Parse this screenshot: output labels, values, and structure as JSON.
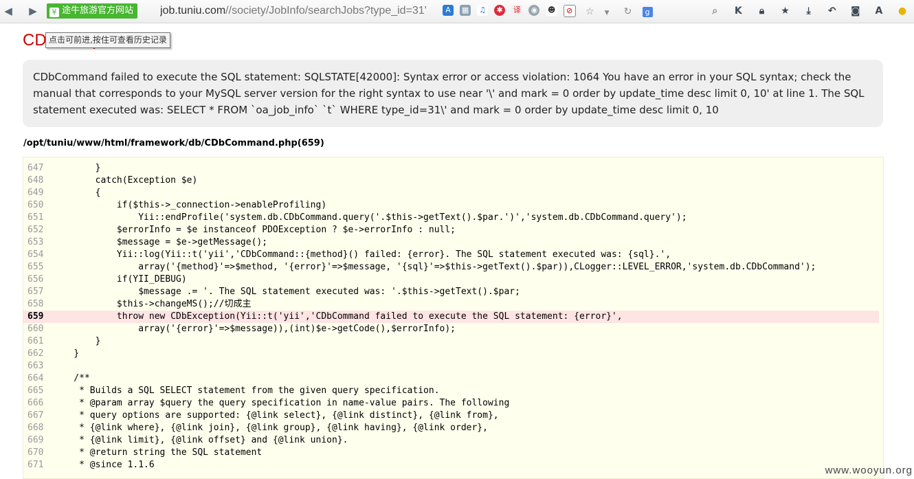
{
  "browser": {
    "site_badge": "途牛旅游官方网站",
    "url_host": "job.tuniu.com",
    "url_path": "//society/JobInfo/searchJobs?type_id=31'",
    "tooltip": "点击可前进,按住可查看历史记录",
    "right_icons": [
      "K",
      "A"
    ]
  },
  "error": {
    "title": "CDbException",
    "message": "CDbCommand failed to execute the SQL statement: SQLSTATE[42000]: Syntax error or access violation: 1064 You have an error in your SQL syntax; check the manual that corresponds to your MySQL server version for the right syntax to use near '\\' and mark = 0 order by update_time desc limit 0, 10' at line 1. The SQL statement executed was: SELECT * FROM `oa_job_info` `t` WHERE type_id=31\\' and mark = 0 order by update_time desc limit 0, 10",
    "file_ref": "/opt/tuniu/www/html/framework/db/CDbCommand.php(659)"
  },
  "source": {
    "error_line": 659,
    "lines": [
      {
        "n": "647",
        "code": "        }"
      },
      {
        "n": "648",
        "code": "        catch(Exception $e)"
      },
      {
        "n": "649",
        "code": "        {"
      },
      {
        "n": "650",
        "code": "            if($this->_connection->enableProfiling)"
      },
      {
        "n": "651",
        "code": "                Yii::endProfile('system.db.CDbCommand.query('.$this->getText().$par.')','system.db.CDbCommand.query');"
      },
      {
        "n": "652",
        "code": "            $errorInfo = $e instanceof PDOException ? $e->errorInfo : null;"
      },
      {
        "n": "653",
        "code": "            $message = $e->getMessage();"
      },
      {
        "n": "654",
        "code": "            Yii::log(Yii::t('yii','CDbCommand::{method}() failed: {error}. The SQL statement executed was: {sql}.',"
      },
      {
        "n": "655",
        "code": "                array('{method}'=>$method, '{error}'=>$message, '{sql}'=>$this->getText().$par)),CLogger::LEVEL_ERROR,'system.db.CDbCommand');"
      },
      {
        "n": "656",
        "code": "            if(YII_DEBUG)"
      },
      {
        "n": "657",
        "code": "                $message .= '. The SQL statement executed was: '.$this->getText().$par;"
      },
      {
        "n": "658",
        "code": "            $this->changeMS();//切成主"
      },
      {
        "n": "659",
        "code": "            throw new CDbException(Yii::t('yii','CDbCommand failed to execute the SQL statement: {error}',"
      },
      {
        "n": "660",
        "code": "                array('{error}'=>$message)),(int)$e->getCode(),$errorInfo);"
      },
      {
        "n": "661",
        "code": "        }"
      },
      {
        "n": "662",
        "code": "    }"
      },
      {
        "n": "663",
        "code": ""
      },
      {
        "n": "664",
        "code": "    /**"
      },
      {
        "n": "665",
        "code": "     * Builds a SQL SELECT statement from the given query specification."
      },
      {
        "n": "666",
        "code": "     * @param array $query the query specification in name-value pairs. The following"
      },
      {
        "n": "667",
        "code": "     * query options are supported: {@link select}, {@link distinct}, {@link from},"
      },
      {
        "n": "668",
        "code": "     * {@link where}, {@link join}, {@link group}, {@link having}, {@link order},"
      },
      {
        "n": "669",
        "code": "     * {@link limit}, {@link offset} and {@link union}."
      },
      {
        "n": "670",
        "code": "     * @return string the SQL statement"
      },
      {
        "n": "671",
        "code": "     * @since 1.1.6"
      }
    ]
  },
  "watermark": "www.wooyun.org",
  "colors": {
    "title_red": "#cc0000",
    "message_bg": "#efefef",
    "source_bg": "#ffffee",
    "error_line_bg": "#ffe4e4",
    "site_badge_green": "#47b631"
  }
}
